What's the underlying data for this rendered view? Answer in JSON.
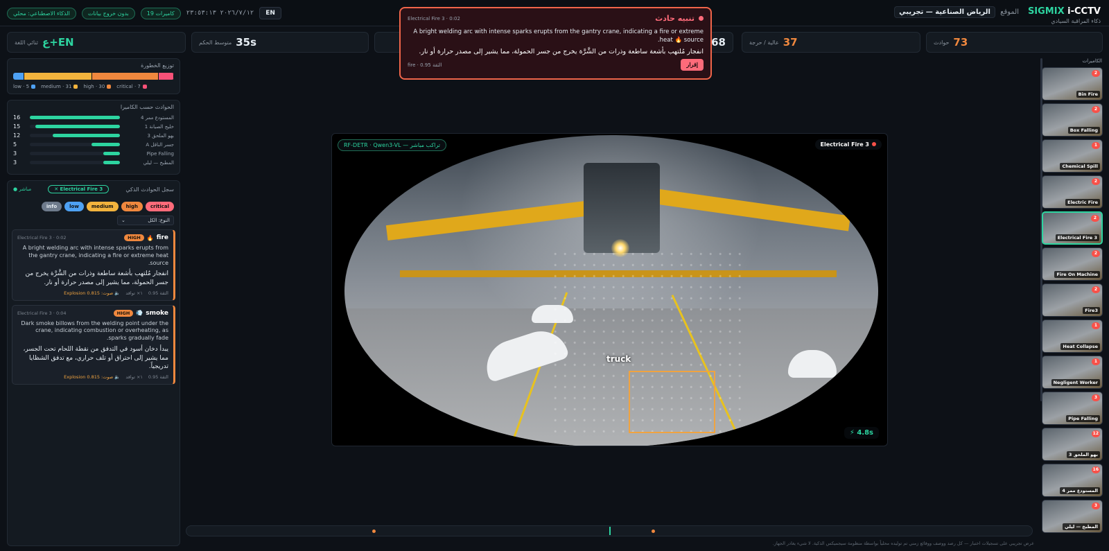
{
  "header": {
    "brand_accent": "SIGMIX",
    "brand_rest": " i-CCTV",
    "brand_sub": "ذكاء المراقبة السيادي",
    "site_label": "الموقع",
    "site_value": "الرياض الصناعية — تجريبي",
    "lang_button": "EN",
    "clock": "٢٠٢٦/٧/١٢ ٢٣:٥٣:١٣",
    "chips": [
      "19 كاميرات",
      "بدون خروج بيانات",
      "الذكاء الاصطناعي: محلي"
    ]
  },
  "kpis": [
    {
      "value": "73",
      "label": "حوادث",
      "color": "#f0883e"
    },
    {
      "value": "37",
      "label": "عالية / حرجة",
      "color": "#f0883e"
    },
    {
      "value": "68",
      "label": "",
      "color": "#e6edf3"
    },
    {
      "value": "35s",
      "label": "متوسط الحكم",
      "color": "#e6edf3"
    },
    {
      "value": "EN+ع",
      "label": "ثنائي اللغة",
      "color": "#2dd4a0"
    }
  ],
  "severity": {
    "title": "توزيع الخطورة",
    "items": [
      {
        "name": "critical",
        "count": 7,
        "color": "#f85178"
      },
      {
        "name": "high",
        "count": 30,
        "color": "#f0883e"
      },
      {
        "name": "medium",
        "count": 31,
        "color": "#f2b33d"
      },
      {
        "name": "low",
        "count": 5,
        "color": "#4ea1f3"
      }
    ],
    "legend": [
      "critical · 7",
      "high · 30",
      "medium · 31",
      "low · 5"
    ]
  },
  "by_camera": {
    "title": "الحوادث حسب الكاميرا",
    "rows": [
      {
        "name": "المستودع ممر 4",
        "count": 16
      },
      {
        "name": "خليج الصيانة 1",
        "count": 15
      },
      {
        "name": "بهو الملحق 3",
        "count": 12
      },
      {
        "name": "جسر الناقل A",
        "count": 5
      },
      {
        "name": "Pipe Falling",
        "count": 3
      },
      {
        "name": "المطبخ — ليلي",
        "count": 3
      }
    ]
  },
  "log": {
    "title": "سجل الحوادث الذكي",
    "filter_chip": "✕ Electrical Fire 3",
    "live": "● مباشر",
    "pills": [
      {
        "label": "critical",
        "color": "#ff6b7a"
      },
      {
        "label": "high",
        "color": "#f0883e"
      },
      {
        "label": "medium",
        "color": "#f2b33d"
      },
      {
        "label": "low",
        "color": "#4ea1f3"
      },
      {
        "label": "info",
        "color": "#6e7b8c"
      }
    ],
    "type_select": "النوع: الكل",
    "events": [
      {
        "type": "fire",
        "icon": "🔥",
        "severity": "HIGH",
        "meta": "Electrical Fire 3 · 0:02",
        "en": "A bright welding arc with intense sparks erupts from the gantry crane, indicating a fire or extreme heat source.",
        "ar": "انفجار مُلتهب بأشعة ساطعة وذرات من الشَّرَّة يخرج من جسر الحمولة، مما يشير إلى مصدر حرارة أو نار.",
        "confidence": "الثقة 0.95",
        "frames": "١× تواقد",
        "sound": "🔈 صوت: Explosion 0.815"
      },
      {
        "type": "smoke",
        "icon": "💨",
        "severity": "HIGH",
        "meta": "Electrical Fire 3 · 0:04",
        "en": "Dark smoke billows from the welding point under the crane, indicating combustion or overheating, as sparks gradually fade.",
        "ar": "يبدأ دخان أسود في التدفق من نقطة اللحام تحت الجسر، مما يشير إلى احتراق أو تلف حراري، مع تدفق الشظايا تدريجياً.",
        "confidence": "الثقة 0.95",
        "frames": "١× تواقد",
        "sound": "🔈 صوت: Explosion 0.815"
      }
    ]
  },
  "video": {
    "pipeline": "RF-DETR · Qwen3-VL — تراكب مباشر",
    "camera": "Electrical Fire 3",
    "detection": "truck",
    "latency": "⚡ 4.8s"
  },
  "alert": {
    "title": "تنبيه حادث",
    "meta": "Electrical Fire 3 · 0:02",
    "en": "A bright welding arc with intense sparks erupts from the gantry crane, indicating a fire or extreme heat 🔥 source.",
    "ar": "انفجار مُلتهب بأشعة ساطعة وذرات من الشَّرَّة يخرج من جسر الحمولة، مما يشير إلى مصدر حرارة أو نار.",
    "ack": "إقرار",
    "conf": "الثقة 0.95 · fire"
  },
  "cameras": {
    "title": "الكاميرات",
    "items": [
      {
        "label": "Bin Fire",
        "count": "2"
      },
      {
        "label": "Box Falling",
        "count": "2"
      },
      {
        "label": "Chemical Spill",
        "count": "1"
      },
      {
        "label": "Electric Fire",
        "count": "2"
      },
      {
        "label": "Electrical Fire 3",
        "count": "2",
        "active": true
      },
      {
        "label": "Fire On Machine",
        "count": "2"
      },
      {
        "label": "Fire3",
        "count": "2"
      },
      {
        "label": "Heat Collapse",
        "count": "1"
      },
      {
        "label": "Negligent Worker",
        "count": "1"
      },
      {
        "label": "Pipe Falling",
        "count": "3"
      },
      {
        "label": "بهو الملحق 3",
        "count": "12"
      },
      {
        "label": "المستودع ممر 4",
        "count": "16"
      },
      {
        "label": "المطبخ — ليلي",
        "count": "3"
      }
    ]
  },
  "timeline": {
    "markers": [
      0.22,
      0.55
    ],
    "cursor": 0.5
  },
  "footer": "عرض تجريبي على تسجيلات اختبار — كل رصد ووصف ووقائع زمني تم توليده محلياً بواسطة منظومة سيجميكس الذكية. لا شيء يغادر الجهاز."
}
